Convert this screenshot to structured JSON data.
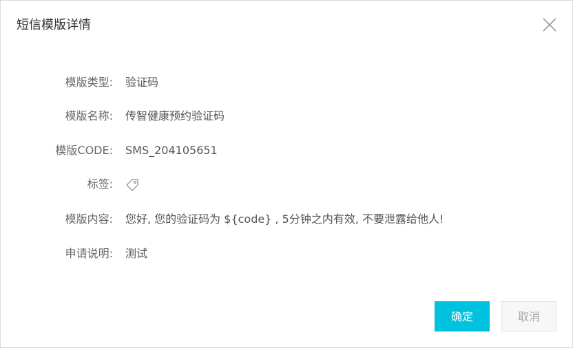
{
  "dialog": {
    "title": "短信模版详情",
    "close_icon": "close-icon"
  },
  "details": [
    {
      "label": "模版类型:",
      "value": "验证码"
    },
    {
      "label": "模版名称:",
      "value": "传智健康预约验证码"
    },
    {
      "label": "模版CODE:",
      "value": "SMS_204105651"
    },
    {
      "label": "标签:",
      "value": "",
      "icon": "tag-icon"
    },
    {
      "label": "模版内容:",
      "value": "您好, 您的验证码为 ${code} , 5分钟之内有效, 不要泄露给他人!"
    },
    {
      "label": "申请说明:",
      "value": "测试"
    }
  ],
  "buttons": {
    "confirm_label": "确定",
    "cancel_label": "取消"
  },
  "colors": {
    "accent": "#00c1de",
    "border": "#d9d9d9",
    "label_text": "#666666",
    "value_text": "#555555"
  }
}
